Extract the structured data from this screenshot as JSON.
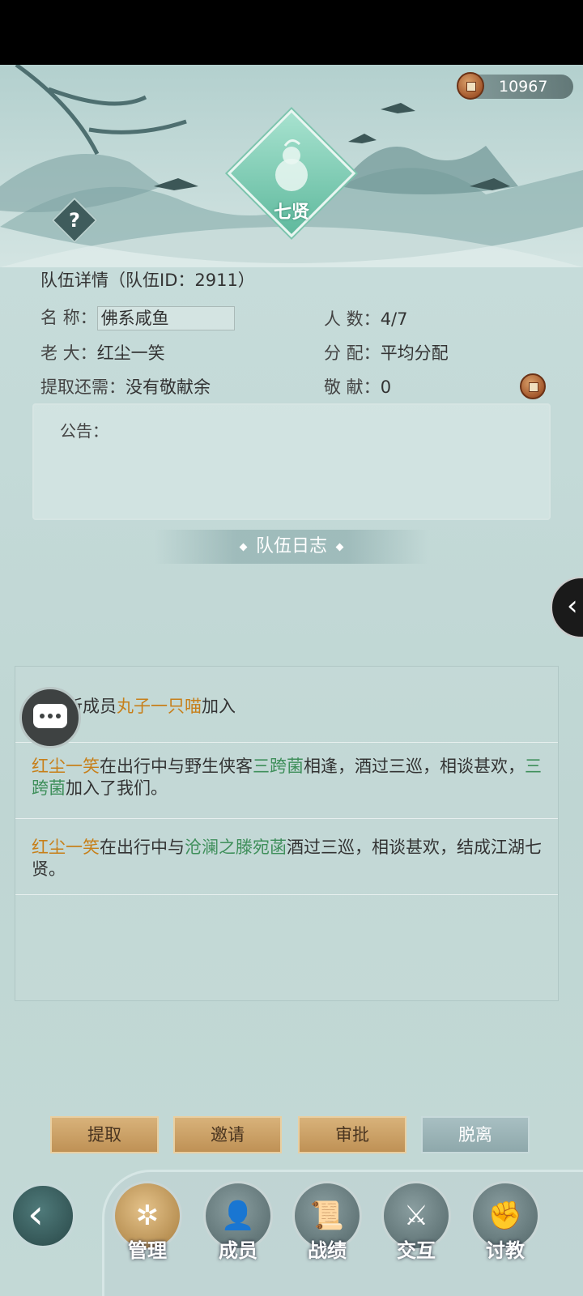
{
  "currency": {
    "amount": "10967"
  },
  "emblem": {
    "name": "七贤"
  },
  "help": {
    "label": "?"
  },
  "details": {
    "title": "队伍详情（队伍ID：2911）",
    "name_label": "名    称：",
    "name_value": "佛系咸鱼",
    "count_label": "人    数：",
    "count_value": "4/7",
    "leader_label": "老    大：",
    "leader_value": "红尘一笑",
    "distribution_label": "分    配：",
    "distribution_value": "平均分配",
    "withdraw_label": "提取还需：",
    "withdraw_value": "没有敬献余",
    "contribution_label": "敬    献：",
    "contribution_value": "0"
  },
  "notice": {
    "label": "公告："
  },
  "log": {
    "header": "队伍日志",
    "entries": [
      {
        "pre": "欢迎新成员",
        "name": "丸子一只喵",
        "post": "加入"
      },
      {
        "name1": "红尘一笑",
        "mid1": "在出行中与野生侠客",
        "name2": "三跨菌",
        "mid2": "相逢，酒过三巡，相谈甚欢，",
        "name3": "三跨菌",
        "post": "加入了我们。"
      },
      {
        "name1": "红尘一笑",
        "mid1": "在出行中与",
        "name2": "沧澜之滕宛菡",
        "post": "酒过三巡，相谈甚欢，结成江湖七贤。"
      }
    ]
  },
  "actions": {
    "withdraw": "提取",
    "invite": "邀请",
    "approve": "审批",
    "leave": "脱离"
  },
  "nav": {
    "back_icon": "back-arrow-icon",
    "items": [
      {
        "label": "管理",
        "icon": "manage-icon"
      },
      {
        "label": "成员",
        "icon": "members-icon"
      },
      {
        "label": "战绩",
        "icon": "record-icon"
      },
      {
        "label": "交互",
        "icon": "interact-icon"
      },
      {
        "label": "讨教",
        "icon": "spar-icon"
      }
    ]
  },
  "colors": {
    "highlight_name": "#c77f19",
    "highlight_npc": "#3f8f5b",
    "button_gold": "#d8b27a"
  }
}
